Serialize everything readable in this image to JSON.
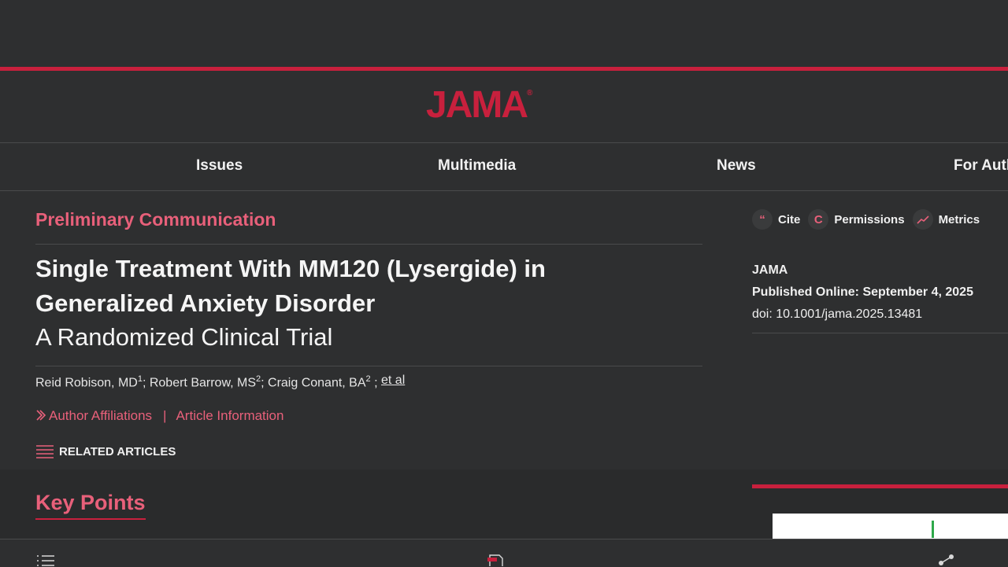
{
  "brand": {
    "logo_text": "JAMA",
    "logo_mark": "®",
    "accent_color": "#c8203d"
  },
  "nav": {
    "items": [
      "Issues",
      "Multimedia",
      "News",
      "For Auth"
    ]
  },
  "article": {
    "type": "Preliminary Communication",
    "title_line1": "Single Treatment With MM120 (Lysergide) in",
    "title_line2": "Generalized Anxiety Disorder",
    "subtitle": "A Randomized Clinical Trial",
    "authors": [
      {
        "name": "Reid Robison, MD",
        "sup": "1",
        "after": "; "
      },
      {
        "name": "Robert Barrow, MS",
        "sup": "2",
        "after": "; "
      },
      {
        "name": "Craig Conant, BA",
        "sup": "2",
        "after": " ; "
      }
    ],
    "et_al": "et al",
    "author_affiliations": "Author Affiliations",
    "separator": "|",
    "article_information": "Article Information",
    "related_articles": "RELATED ARTICLES",
    "key_points": "Key Points"
  },
  "sidebar": {
    "tools": [
      {
        "label": "Cite",
        "icon": "quote-icon",
        "glyph": "“"
      },
      {
        "label": "Permissions",
        "icon": "copyright-icon",
        "glyph": "C"
      },
      {
        "label": "Metrics",
        "icon": "trend-icon",
        "glyph": ""
      }
    ],
    "journal": "JAMA",
    "published": "Published Online: September 4, 2025",
    "doi": "doi: 10.1001/jama.2025.13481"
  }
}
